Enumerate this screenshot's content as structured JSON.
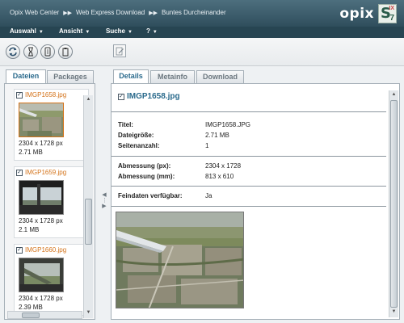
{
  "header": {
    "breadcrumb": [
      "Opix Web Center",
      "Web Express Download",
      "Buntes Durcheinander"
    ],
    "logo_text": "opix"
  },
  "menu": [
    "Auswahl",
    "Ansicht",
    "Suche",
    "?"
  ],
  "toolbar": {
    "icons": [
      "refresh-icon",
      "hourglass-icon",
      "info-icon",
      "clipboard-icon",
      "edit-icon"
    ]
  },
  "left_tabs": [
    "Dateien",
    "Packages"
  ],
  "files": [
    {
      "name": "IMGP1658.jpg",
      "dims": "2304 x 1728 px",
      "size": "2.71 MB",
      "checked": true
    },
    {
      "name": "IMGP1659.jpg",
      "dims": "2304 x 1728 px",
      "size": "2.1 MB",
      "checked": true
    },
    {
      "name": "IMGP1660.jpg",
      "dims": "2304 x 1728 px",
      "size": "2.39 MB",
      "checked": true
    }
  ],
  "right_tabs": [
    "Details",
    "Metainfo",
    "Download"
  ],
  "details": {
    "title": "IMGP1658.jpg",
    "rows": [
      {
        "label": "Titel:",
        "value": "IMGP1658.JPG"
      },
      {
        "label": "Dateigröße:",
        "value": "2.71 MB"
      },
      {
        "label": "Seitenanzahl:",
        "value": "1"
      },
      {
        "label": "Abmessung (px):",
        "value": "2304 x 1728"
      },
      {
        "label": "Abmessung (mm):",
        "value": "813 x 610"
      },
      {
        "label": "Feindaten verfügbar:",
        "value": "Ja"
      }
    ]
  },
  "colors": {
    "header": "#2f4e5c",
    "menubar": "#274552",
    "filename": "#d4731a",
    "title_link": "#2a6a8c"
  }
}
